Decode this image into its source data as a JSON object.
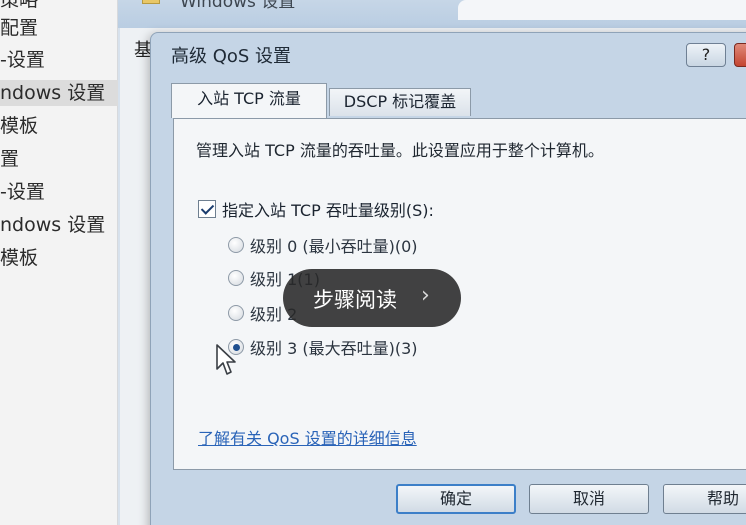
{
  "left_tree": {
    "items": [
      {
        "label": "策略"
      },
      {
        "label": "配置"
      },
      {
        "label": "-设置"
      },
      {
        "label": "ndows 设置"
      },
      {
        "label": "模板"
      },
      {
        "label": "置"
      },
      {
        "label": "-设置"
      },
      {
        "label": "ndows 设置"
      },
      {
        "label": "模板"
      }
    ]
  },
  "background_window": {
    "title": "Windows 设置",
    "label": "基"
  },
  "dialog": {
    "title": "高级 QoS 设置",
    "help_button": "?",
    "close_button": "✕",
    "tabs": [
      {
        "label": "入站 TCP 流量"
      },
      {
        "label": "DSCP 标记覆盖"
      }
    ],
    "description": "管理入站 TCP 流量的吞吐量。此设置应用于整个计算机。",
    "checkbox_label": "指定入站 TCP 吞吐量级别(S):",
    "radios": [
      {
        "label": "级别 0 (最小吞吐量)(0)"
      },
      {
        "label": "级别 1(1)"
      },
      {
        "label": "级别 2"
      },
      {
        "label": "级别 3 (最大吞吐量)(3)"
      }
    ],
    "link": "了解有关 QoS 设置的详细信息",
    "buttons": {
      "ok": "确定",
      "cancel": "取消",
      "help": "帮助"
    }
  },
  "overlay": {
    "label": "步骤阅读",
    "chevron": "›"
  }
}
